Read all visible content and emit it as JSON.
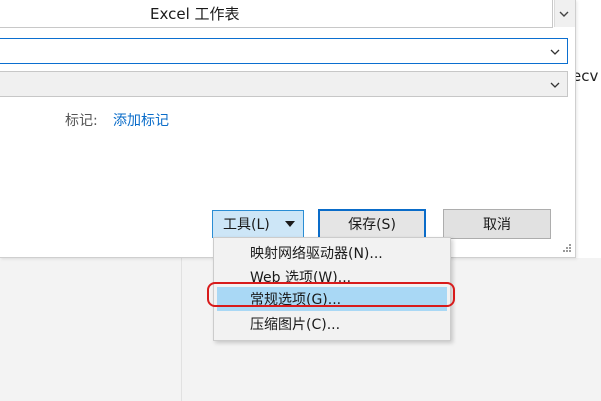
{
  "file_type_list": {
    "item": "Excel 工作表"
  },
  "filename_field": {
    "value": ""
  },
  "save_type_field": {
    "value": ""
  },
  "tags": {
    "label": "标记:",
    "link": "添加标记"
  },
  "buttons": {
    "tools": "工具(L)",
    "save": "保存(S)",
    "cancel": "取消"
  },
  "tools_menu": {
    "items": [
      "映射网络驱动器(N)...",
      "Web 选项(W)...",
      "常规选项(G)...",
      "压缩图片(C)..."
    ],
    "highlighted_index": 2
  },
  "background": {
    "partial_text": "ecv"
  },
  "colors": {
    "accent": "#0a6cc9",
    "highlight": "#a9d8f5",
    "annotation": "#d81b1b"
  }
}
